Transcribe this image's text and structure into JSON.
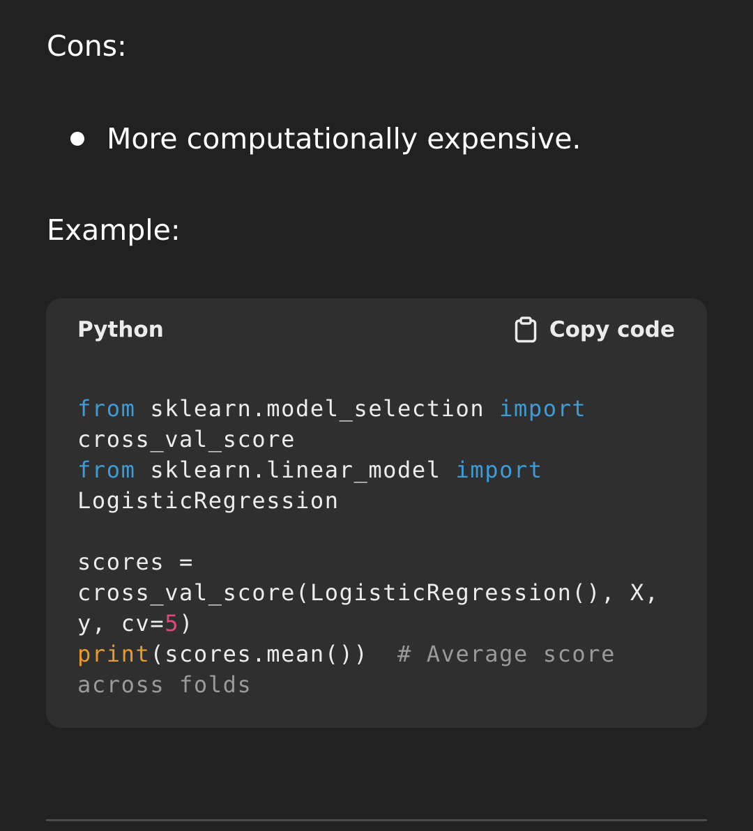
{
  "cons_heading": "Cons:",
  "cons_items": [
    "More computationally expensive."
  ],
  "example_heading": "Example:",
  "code_block": {
    "language": "Python",
    "copy_label": "Copy code",
    "copy_icon": "clipboard-icon",
    "lines": [
      [
        {
          "t": "from",
          "c": "kw"
        },
        {
          "t": " sklearn.model_selection ",
          "c": "txt"
        },
        {
          "t": "import",
          "c": "kw"
        }
      ],
      [
        {
          "t": "cross_val_score",
          "c": "txt"
        }
      ],
      [
        {
          "t": "from",
          "c": "kw"
        },
        {
          "t": " sklearn.linear_model ",
          "c": "txt"
        },
        {
          "t": "import",
          "c": "kw"
        }
      ],
      [
        {
          "t": "LogisticRegression",
          "c": "txt"
        }
      ],
      [],
      [
        {
          "t": "scores =",
          "c": "txt"
        }
      ],
      [
        {
          "t": "cross_val_score(LogisticRegression(), X,",
          "c": "txt"
        }
      ],
      [
        {
          "t": "y, cv=",
          "c": "txt"
        },
        {
          "t": "5",
          "c": "num"
        },
        {
          "t": ")",
          "c": "txt"
        }
      ],
      [
        {
          "t": "print",
          "c": "fn"
        },
        {
          "t": "(scores.mean())  ",
          "c": "txt"
        },
        {
          "t": "# Average score",
          "c": "cm"
        }
      ],
      [
        {
          "t": "across folds",
          "c": "cm"
        }
      ]
    ]
  },
  "colors": {
    "background": "#212121",
    "code_background": "#2f2f2f",
    "keyword": "#3d9bd6",
    "builtin": "#e59b2f",
    "number": "#e0497a",
    "comment": "#9a9a9a"
  }
}
